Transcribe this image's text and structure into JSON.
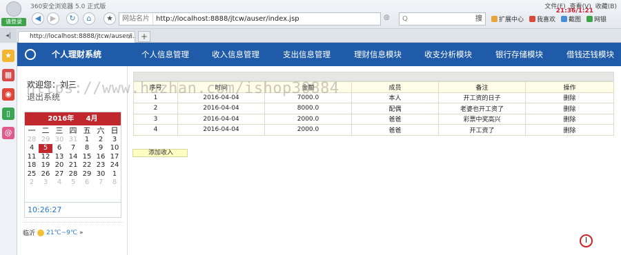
{
  "browser": {
    "login_label": "请登录",
    "app_title": "360安全浏览器 5.0 正式版",
    "menu": [
      "文件(F)",
      "查看(V)",
      "收藏(B)"
    ],
    "clock_overlay": "21:36/1:21",
    "address_prefix": "网站名片",
    "url": "http://localhost:8888/jtcw/auser/index.jsp",
    "search_placeholder": "Q",
    "search_button": "搜",
    "toolbar": [
      "扩展中心",
      "我喜欢",
      "截图",
      "网银"
    ],
    "tab_title": "http://localhost:8888/jtcw/auser/i...",
    "new_tab": "+"
  },
  "header": {
    "app_name": "个人理财系统",
    "nav": [
      "个人信息管理",
      "收入信息管理",
      "支出信息管理",
      "理财信息模块",
      "收支分析模块",
      "银行存储模块",
      "借钱还钱模块"
    ]
  },
  "sidebar": {
    "welcome": "欢迎您：刘三",
    "logout": "退出系统",
    "calendar": {
      "year": "2016年",
      "month": "4月",
      "weekdays": [
        "一",
        "二",
        "三",
        "四",
        "五",
        "六",
        "日"
      ],
      "days": [
        "28",
        "29",
        "30",
        "31",
        "1",
        "2",
        "3",
        "4",
        "5",
        "6",
        "7",
        "8",
        "9",
        "10",
        "11",
        "12",
        "13",
        "14",
        "15",
        "16",
        "17",
        "18",
        "19",
        "20",
        "21",
        "22",
        "23",
        "24",
        "25",
        "26",
        "27",
        "28",
        "29",
        "30",
        "1",
        "2",
        "3",
        "4",
        "5",
        "6",
        "7",
        "8"
      ],
      "muted_leading": 4,
      "muted_trailing": 7,
      "today": "5"
    },
    "clock": "10:26:27",
    "weather": {
      "city": "临沂",
      "temp": "21℃~9℃",
      "more": "»"
    }
  },
  "table": {
    "headers": [
      "序号",
      "时间",
      "金额",
      "成员",
      "备注",
      "操作"
    ],
    "rows": [
      [
        "1",
        "2016-04-04",
        "7000.0",
        "本人",
        "开工资的日子",
        "删除"
      ],
      [
        "2",
        "2016-04-04",
        "8000.0",
        "配偶",
        "老婆也开工资了",
        "删除"
      ],
      [
        "3",
        "2016-04-04",
        "2000.0",
        "爸爸",
        "彩票中奖高兴",
        "删除"
      ],
      [
        "4",
        "2016-04-04",
        "2000.0",
        "爸爸",
        "开工资了",
        "删除"
      ]
    ],
    "add_button": "添加收入"
  },
  "watermark": "https://www.huzhan.com/ishop30884",
  "cursor_glyph": "I"
}
